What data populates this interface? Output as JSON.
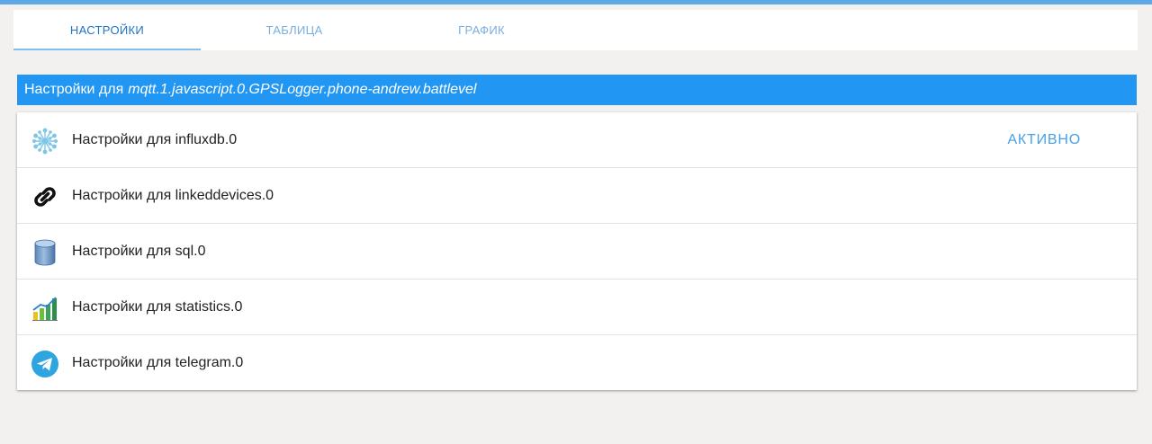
{
  "tabs": [
    {
      "label": "НАСТРОЙКИ",
      "active": true
    },
    {
      "label": "ТАБЛИЦА",
      "active": false
    },
    {
      "label": "ГРАФИК",
      "active": false
    }
  ],
  "header": {
    "prefix": "Настройки для",
    "object_id": "mqtt.1.javascript.0.GPSLogger.phone-andrew.battlevel"
  },
  "instances": [
    {
      "icon": "influxdb-icon",
      "label": "Настройки для influxdb.0",
      "status": "АКТИВНО"
    },
    {
      "icon": "link-icon",
      "label": "Настройки для linkeddevices.0",
      "status": ""
    },
    {
      "icon": "database-icon",
      "label": "Настройки для sql.0",
      "status": ""
    },
    {
      "icon": "statistics-chart-icon",
      "label": "Настройки для statistics.0",
      "status": ""
    },
    {
      "icon": "telegram-icon",
      "label": "Настройки для telegram.0",
      "status": ""
    }
  ],
  "colors": {
    "accent": "#2196f3",
    "tab_active": "#1e74c6",
    "tab_inactive": "#79aede",
    "status_active": "#4aa0e6",
    "background": "#f3f1ef"
  }
}
